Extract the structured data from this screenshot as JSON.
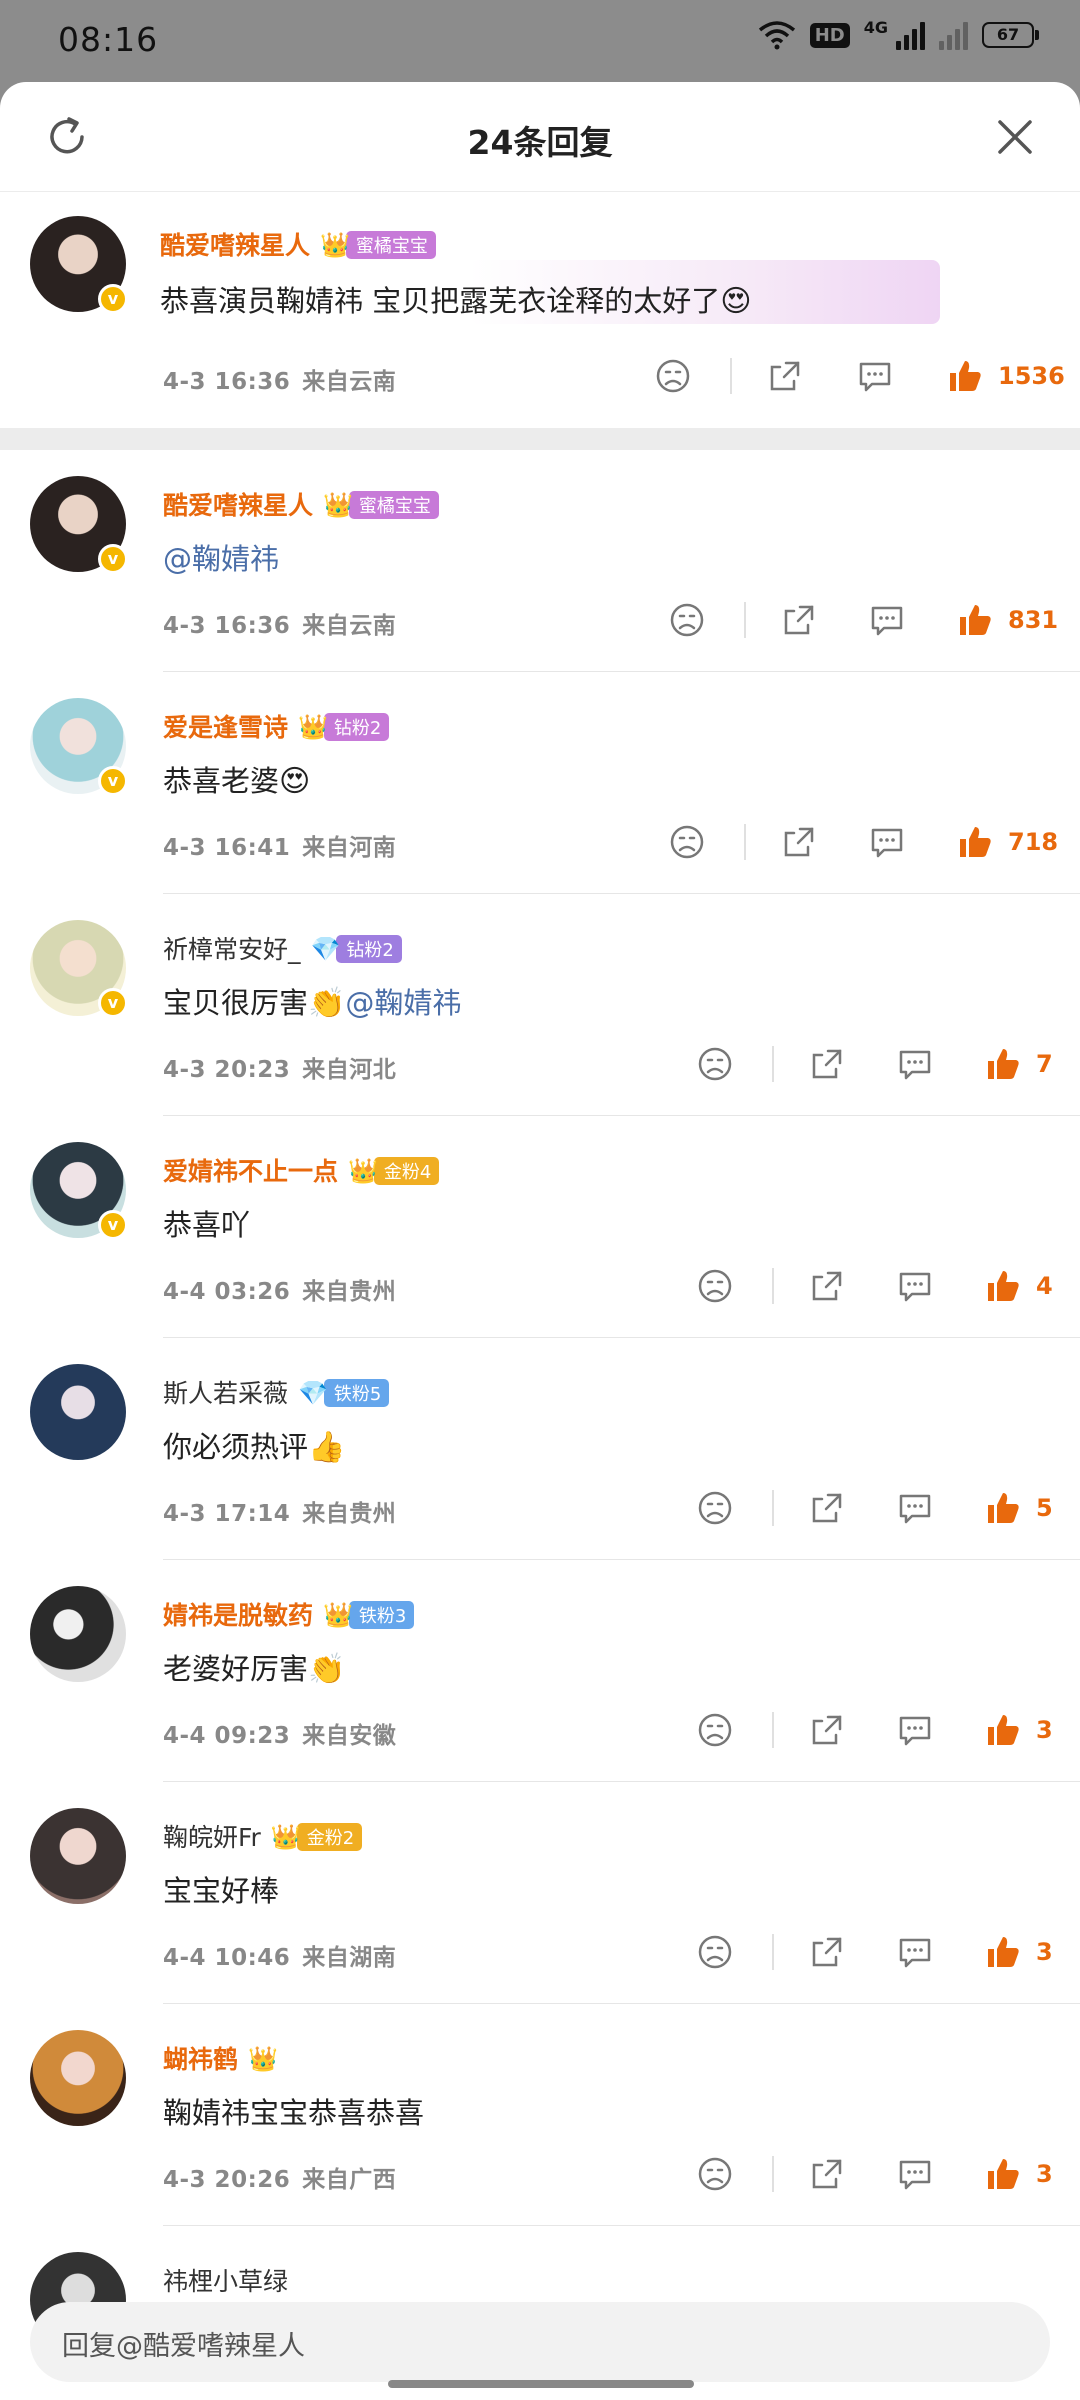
{
  "status": {
    "time": "08:16",
    "hd": "HD",
    "net": "4G",
    "battery": "67"
  },
  "header": {
    "title": "24条回复"
  },
  "main": {
    "name": "酷爱嗜辣星人",
    "badge": "蜜橘宝宝",
    "text": "恭喜演员鞠婧祎  宝贝把露芜衣诠释的太好了",
    "emoji": "😍",
    "date": "4-3  16:36",
    "location": "来自云南",
    "likes": "1536"
  },
  "replies": [
    {
      "name": "酷爱嗜辣星人",
      "badge": "蜜橘宝宝",
      "badge_color": "purple",
      "name_style": "orange",
      "text": "",
      "mention": "@鞠婧祎",
      "emoji": "",
      "date": "4-3  16:36",
      "location": "来自云南",
      "likes": "831"
    },
    {
      "name": "爱是逢雪诗",
      "badge": "钻粉2",
      "badge_color": "purple",
      "name_style": "orange",
      "text": "恭喜老婆",
      "mention": "",
      "emoji": "😍",
      "date": "4-3  16:41",
      "location": "来自河南",
      "likes": "718"
    },
    {
      "name": "祈樟常安好_",
      "badge": "钻粉2",
      "badge_color": "violet",
      "name_style": "plain",
      "text": "宝贝很厉害",
      "mention": "@鞠婧祎",
      "emoji": "👏",
      "date": "4-3  20:23",
      "location": "来自河北",
      "likes": "7"
    },
    {
      "name": "爱婧祎不止一点",
      "badge": "金粉4",
      "badge_color": "gold",
      "name_style": "orange",
      "text": "恭喜吖",
      "mention": "",
      "emoji": "",
      "date": "4-4  03:26",
      "location": "来自贵州",
      "likes": "4"
    },
    {
      "name": "斯人若采薇",
      "badge": "铁粉5",
      "badge_color": "blue",
      "name_style": "plain",
      "text": "你必须热评",
      "mention": "",
      "emoji": "👍",
      "date": "4-3  17:14",
      "location": "来自贵州",
      "likes": "5"
    },
    {
      "name": "婧祎是脱敏药",
      "badge": "铁粉3",
      "badge_color": "blue",
      "name_style": "orange",
      "text": "老婆好厉害",
      "mention": "",
      "emoji": "👏",
      "date": "4-4  09:23",
      "location": "来自安徽",
      "likes": "3"
    },
    {
      "name": "鞠皖妍Fr",
      "badge": "金粉2",
      "badge_color": "gold",
      "name_style": "plain",
      "text": "宝宝好棒",
      "mention": "",
      "emoji": "",
      "date": "4-4  10:46",
      "location": "来自湖南",
      "likes": "3"
    },
    {
      "name": "蝴祎鹤",
      "badge": "",
      "badge_color": "gold",
      "name_style": "orange",
      "text": "鞠婧祎宝宝恭喜恭喜",
      "mention": "",
      "emoji": "",
      "date": "4-3  20:26",
      "location": "来自广西",
      "likes": "3"
    },
    {
      "name": "祎梩小草绿",
      "badge": "",
      "badge_color": "",
      "name_style": "plain",
      "text": "",
      "mention": "",
      "emoji": "",
      "date": "",
      "location": "",
      "likes": ""
    }
  ],
  "input": {
    "placeholder": "回复@酷爱嗜辣星人"
  },
  "colors": {
    "accent": "#e8690d",
    "link": "#4a6ea8",
    "verified": "#f5b700"
  }
}
